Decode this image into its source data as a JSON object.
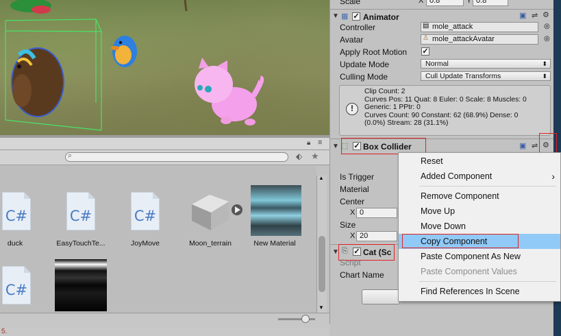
{
  "scene": {
    "label": "Scene view"
  },
  "project": {
    "assets_row1": [
      {
        "name": "duck",
        "icon": "csharp-script-icon",
        "glyph": "C#"
      },
      {
        "name": "EasyTouchTe...",
        "icon": "csharp-script-icon",
        "glyph": "C#"
      },
      {
        "name": "JoyMove",
        "icon": "csharp-script-icon",
        "glyph": "C#"
      },
      {
        "name": "Moon_terrain",
        "icon": "package-box-icon",
        "glyph": ""
      },
      {
        "name": "New Material",
        "icon": "material-icon",
        "glyph": ""
      }
    ],
    "assets_row2": [
      {
        "name": "",
        "icon": "csharp-script-icon",
        "glyph": "C#"
      },
      {
        "name": "",
        "icon": "texture-icon",
        "glyph": ""
      }
    ]
  },
  "console": {
    "text": "5."
  },
  "inspector": {
    "scale_label": "Scale",
    "scale_x": "0.8",
    "scale_y": "0.8",
    "animator": {
      "title": "Animator",
      "controller_label": "Controller",
      "controller_value": "mole_attack",
      "avatar_label": "Avatar",
      "avatar_value": "mole_attackAvatar",
      "apply_root_motion_label": "Apply Root Motion",
      "update_mode_label": "Update Mode",
      "update_mode_value": "Normal",
      "culling_mode_label": "Culling Mode",
      "culling_mode_value": "Cull Update Transforms",
      "info_lines": "Clip Count: 2\nCurves Pos: 11 Quat: 8 Euler: 0 Scale: 8 Muscles: 0\nGeneric: 1 PPtr: 0\nCurves Count: 90 Constant: 62 (68.9%) Dense: 0\n(0.0%) Stream: 28 (31.1%)"
    },
    "box_collider": {
      "title": "Box Collider",
      "is_trigger_label": "Is Trigger",
      "material_label": "Material",
      "center_label": "Center",
      "center_x_label": "X",
      "center_x_value": "0",
      "size_label": "Size",
      "size_x_label": "X",
      "size_x_value": "20"
    },
    "cat": {
      "title": "Cat (Sc",
      "script_label": "Script",
      "chart_name_label": "Chart Name"
    }
  },
  "context_menu": {
    "items": [
      {
        "label": "Reset",
        "state": "normal"
      },
      {
        "label": "Added Component",
        "state": "submenu"
      },
      {
        "label": "Remove Component",
        "state": "normal"
      },
      {
        "label": "Move Up",
        "state": "normal"
      },
      {
        "label": "Move Down",
        "state": "normal"
      },
      {
        "label": "Copy Component",
        "state": "highlighted"
      },
      {
        "label": "Paste Component As New",
        "state": "normal"
      },
      {
        "label": "Paste Component Values",
        "state": "disabled"
      },
      {
        "label": "Find References In Scene",
        "state": "normal"
      }
    ],
    "submenu_arrow": "›"
  },
  "colors": {
    "highlight": "#91c9f7",
    "annotation_red": "#e02020",
    "csharp_blue": "#4a7cc3"
  }
}
